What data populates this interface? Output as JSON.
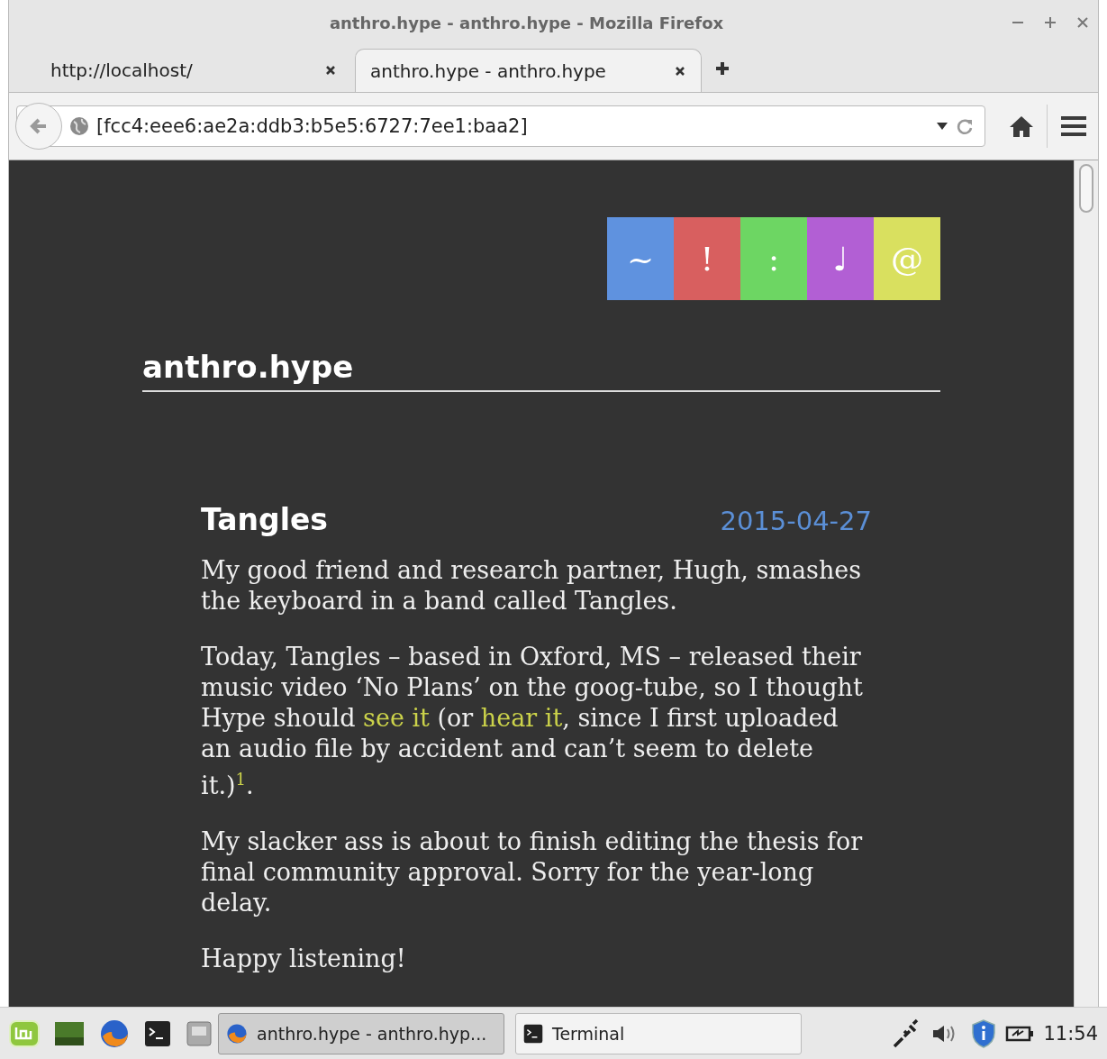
{
  "window": {
    "title": "anthro.hype - anthro.hype - Mozilla Firefox"
  },
  "tabs": [
    {
      "label": "http://localhost/",
      "selected": false
    },
    {
      "label": "anthro.hype - anthro.hype",
      "selected": true
    }
  ],
  "address": {
    "value": "[fcc4:eee6:ae2a:ddb3:b5e5:6727:7ee1:baa2]"
  },
  "site": {
    "nav": [
      {
        "label": "~",
        "color": "#5f92df"
      },
      {
        "label": "!",
        "color": "#d85f5f"
      },
      {
        "label": ":",
        "color": "#6dd663"
      },
      {
        "label": "♩",
        "color": "#b25fd4"
      },
      {
        "label": "@",
        "color": "#d9e05f"
      }
    ],
    "title": "anthro.hype"
  },
  "post": {
    "title": "Tangles",
    "date": "2015-04-27",
    "paragraphs": [
      [
        {
          "kind": "text",
          "text": "My good friend and research partner, Hugh, smashes the keyboard in a band called Tangles."
        }
      ],
      [
        {
          "kind": "text",
          "text": "Today, Tangles – based in Oxford, MS – released their music video ‘No Plans’ on the goog-tube, so I thought Hype should "
        },
        {
          "kind": "link",
          "text": "see it"
        },
        {
          "kind": "text",
          "text": " (or "
        },
        {
          "kind": "link",
          "text": "hear it"
        },
        {
          "kind": "text",
          "text": ", since I first uploaded an audio file by accident and can’t seem to delete it.)"
        },
        {
          "kind": "footnote",
          "text": "1"
        },
        {
          "kind": "text",
          "text": "."
        }
      ],
      [
        {
          "kind": "text",
          "text": "My slacker ass is about to finish editing the thesis for final community approval. Sorry for the year-long delay."
        }
      ],
      [
        {
          "kind": "text",
          "text": "Happy listening!"
        }
      ]
    ]
  },
  "taskbar": {
    "tasks": [
      {
        "label": "anthro.hype - anthro.hyp...",
        "selected": true
      },
      {
        "label": "Terminal",
        "selected": false
      }
    ],
    "clock": "11:54"
  }
}
